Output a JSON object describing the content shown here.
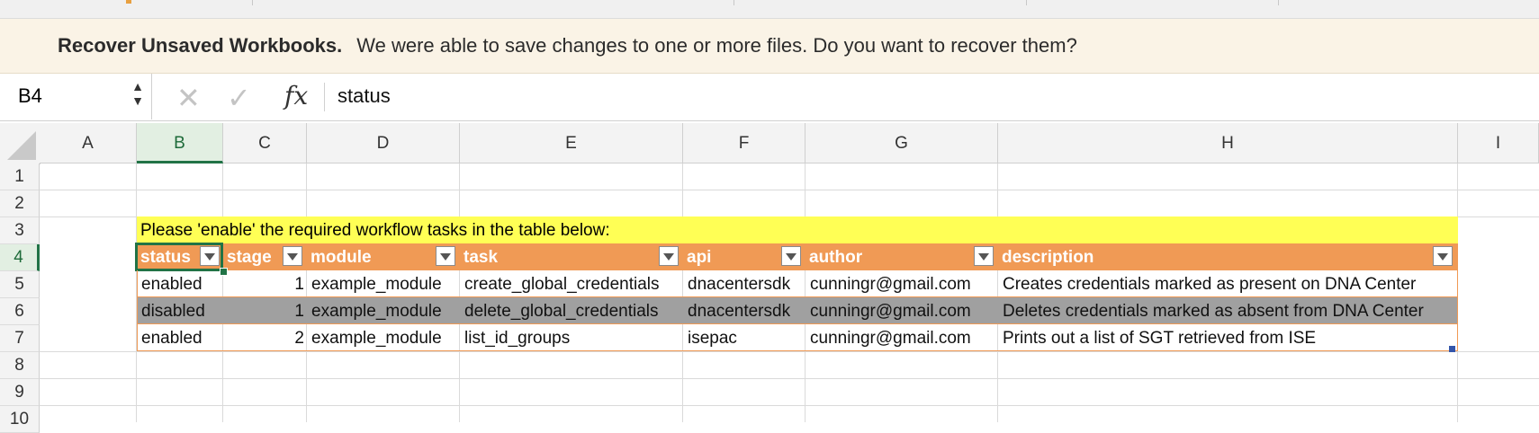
{
  "banner": {
    "title": "Recover Unsaved Workbooks.",
    "message": "We were able to save changes to one or more files. Do you want to recover them?"
  },
  "formula_bar": {
    "name_box": "B4",
    "cancel_icon": "close-icon",
    "enter_icon": "check-icon",
    "fx_label": "fx",
    "content": "status"
  },
  "columns": [
    "A",
    "B",
    "C",
    "D",
    "E",
    "F",
    "G",
    "H",
    "I"
  ],
  "selected_column": "B",
  "rows": [
    "1",
    "2",
    "3",
    "4",
    "5",
    "6",
    "7",
    "8",
    "9",
    "10"
  ],
  "selected_row": "4",
  "sheet": {
    "instruction": "Please 'enable' the required workflow tasks in the table below:",
    "headers": [
      "status",
      "stage",
      "module",
      "task",
      "api",
      "author",
      "description"
    ],
    "data": [
      [
        "enabled",
        "1",
        "example_module",
        "create_global_credentials",
        "dnacentersdk",
        "cunningr@gmail.com",
        "Creates credentials marked as present on DNA Center"
      ],
      [
        "disabled",
        "1",
        "example_module",
        "delete_global_credentials",
        "dnacentersdk",
        "cunningr@gmail.com",
        "Deletes credentials marked as absent from DNA Center"
      ],
      [
        "enabled",
        "2",
        "example_module",
        "list_id_groups",
        "isepac",
        "cunningr@gmail.com",
        "Prints out a list of SGT retrieved from ISE"
      ]
    ]
  },
  "colors": {
    "instruction_fill": "#ffff55",
    "header_fill": "#f09a55",
    "disabled_fill": "#a0a0a0",
    "selection": "#217346",
    "banner_bg": "#faf3e6"
  }
}
